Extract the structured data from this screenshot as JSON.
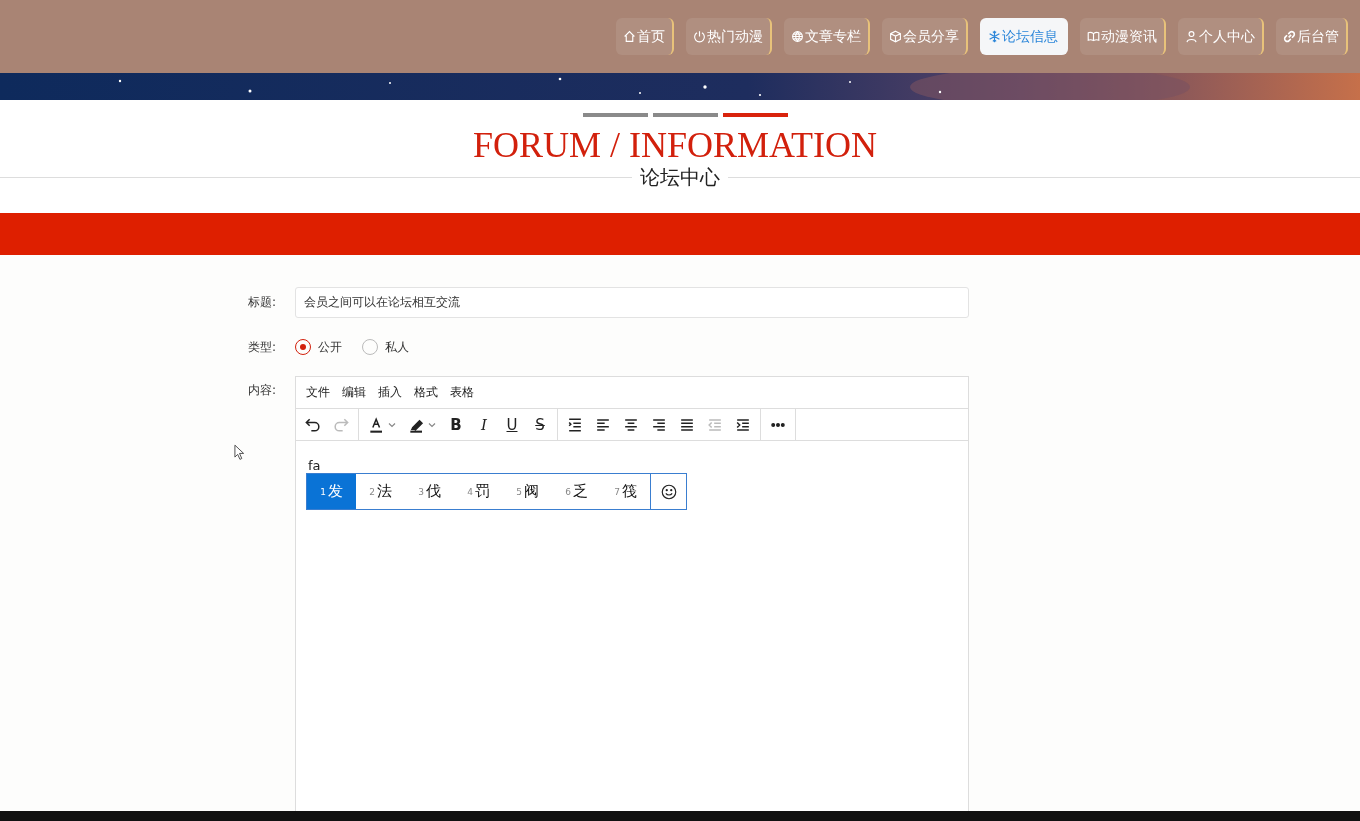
{
  "nav": [
    {
      "kind": "home",
      "label": "首页",
      "selected": false
    },
    {
      "kind": "power",
      "label": "热门动漫",
      "selected": false
    },
    {
      "kind": "globe",
      "label": "文章专栏",
      "selected": false
    },
    {
      "kind": "cube",
      "label": "会员分享",
      "selected": false
    },
    {
      "kind": "snowflake",
      "label": "论坛信息",
      "selected": true
    },
    {
      "kind": "book",
      "label": "动漫资讯",
      "selected": false
    },
    {
      "kind": "person",
      "label": "个人中心",
      "selected": false
    },
    {
      "kind": "link",
      "label": "后台管",
      "selected": false
    }
  ],
  "heading": {
    "title": "FORUM / INFORMATION",
    "subtitle": "论坛中心",
    "bars": [
      {
        "selected": false
      },
      {
        "selected": false
      },
      {
        "selected": true
      }
    ]
  },
  "form": {
    "title_label": "标题:",
    "title_value": "会员之间可以在论坛相互交流",
    "type_label": "类型:",
    "types": [
      {
        "label": "公开",
        "selected": true
      },
      {
        "label": "私人",
        "selected": false
      }
    ],
    "content_label": "内容:",
    "menu": [
      "文件",
      "编辑",
      "插入",
      "格式",
      "表格"
    ],
    "toolbar": [
      [
        {
          "kind": "undo",
          "disabled": false
        },
        {
          "kind": "redo",
          "disabled": true
        }
      ],
      [
        {
          "kind": "textcolor",
          "disabled": false
        },
        {
          "kind": "highlight",
          "disabled": false
        },
        {
          "kind": "bold",
          "label": "B",
          "disabled": false
        },
        {
          "kind": "italic",
          "label": "I",
          "disabled": false
        },
        {
          "kind": "underline",
          "label": "U",
          "disabled": false
        },
        {
          "kind": "strike",
          "label": "S",
          "disabled": false
        }
      ],
      [
        {
          "kind": "linespacing",
          "disabled": false
        },
        {
          "kind": "alignleft",
          "disabled": false
        },
        {
          "kind": "aligncenter",
          "disabled": false
        },
        {
          "kind": "alignright",
          "disabled": false
        },
        {
          "kind": "justify",
          "disabled": false
        },
        {
          "kind": "outdent",
          "disabled": true
        },
        {
          "kind": "indent",
          "disabled": false
        }
      ],
      [
        {
          "kind": "more",
          "disabled": false
        }
      ]
    ],
    "typed": "fa",
    "candidates": [
      {
        "index": "1",
        "text": "发",
        "selected": true
      },
      {
        "index": "2",
        "text": "法",
        "selected": false
      },
      {
        "index": "3",
        "text": "伐",
        "selected": false
      },
      {
        "index": "4",
        "text": "罚",
        "selected": false
      },
      {
        "index": "5",
        "text": "阀",
        "selected": false
      },
      {
        "index": "6",
        "text": "乏",
        "selected": false
      },
      {
        "index": "7",
        "text": "筏",
        "selected": false
      }
    ]
  }
}
